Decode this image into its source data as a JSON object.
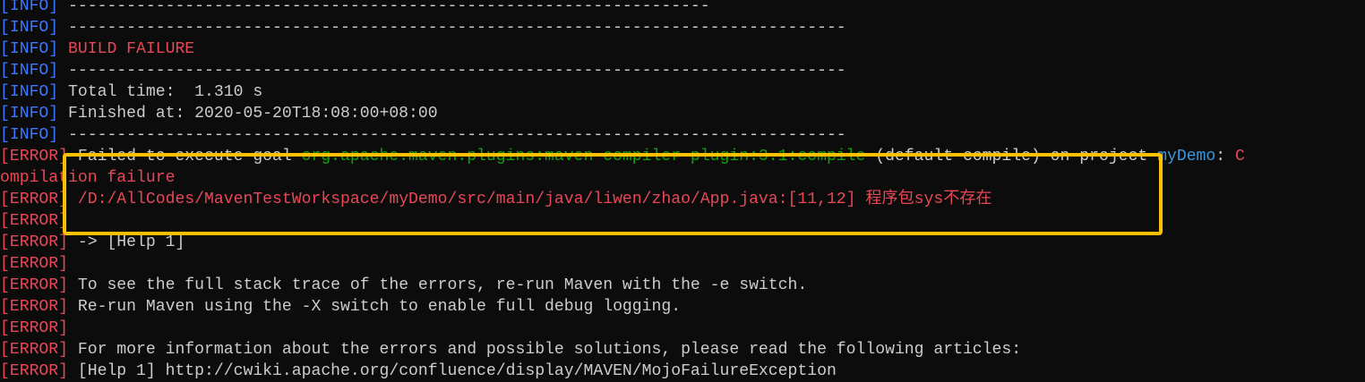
{
  "colors": {
    "gray": "#cccccc",
    "blue": "#3b78ff",
    "red": "#e74856",
    "green": "#13a10e",
    "cyan": "#3a96dd",
    "highlight": "#ffc000",
    "background": "#0c0c0c"
  },
  "lines": [
    [
      {
        "t": "[INFO]",
        "c": "blue"
      },
      {
        "t": " ------------------------------------------------------------------",
        "c": "gray"
      }
    ],
    [
      {
        "t": "[INFO]",
        "c": "blue"
      },
      {
        "t": " --------------------------------------------------------------------------------",
        "c": "gray"
      }
    ],
    [
      {
        "t": "[INFO]",
        "c": "blue"
      },
      {
        "t": " ",
        "c": "gray"
      },
      {
        "t": "BUILD FAILURE",
        "c": "red"
      }
    ],
    [
      {
        "t": "[INFO]",
        "c": "blue"
      },
      {
        "t": " --------------------------------------------------------------------------------",
        "c": "gray"
      }
    ],
    [
      {
        "t": "[INFO]",
        "c": "blue"
      },
      {
        "t": " Total time:  1.310 s",
        "c": "gray"
      }
    ],
    [
      {
        "t": "[INFO]",
        "c": "blue"
      },
      {
        "t": " Finished at: 2020-05-20T18:08:00+08:00",
        "c": "gray"
      }
    ],
    [
      {
        "t": "[INFO]",
        "c": "blue"
      },
      {
        "t": " --------------------------------------------------------------------------------",
        "c": "gray"
      }
    ],
    [
      {
        "t": "[ERROR]",
        "c": "red"
      },
      {
        "t": " Failed to execute goal ",
        "c": "gray"
      },
      {
        "t": "org.apache.maven.plugins:maven-compiler-plugin:3.1:compile",
        "c": "green"
      },
      {
        "t": " (default-compile) on project ",
        "c": "gray"
      },
      {
        "t": "myDemo",
        "c": "cyan"
      },
      {
        "t": ": ",
        "c": "gray"
      },
      {
        "t": "C",
        "c": "red"
      }
    ],
    [
      {
        "t": "ompilation failure",
        "c": "red"
      }
    ],
    [
      {
        "t": "[ERROR]",
        "c": "red"
      },
      {
        "t": " /D:/AllCodes/MavenTestWorkspace/myDemo/src/main/java/liwen/zhao/App.java:[11,12] 程序包sys不存在",
        "c": "red"
      }
    ],
    [
      {
        "t": "[ERROR]",
        "c": "red"
      }
    ],
    [
      {
        "t": "[ERROR]",
        "c": "red"
      },
      {
        "t": " -> [Help 1]",
        "c": "gray"
      }
    ],
    [
      {
        "t": "[ERROR]",
        "c": "red"
      }
    ],
    [
      {
        "t": "[ERROR]",
        "c": "red"
      },
      {
        "t": " To see the full stack trace of the errors, re-run Maven with the -e switch.",
        "c": "gray"
      }
    ],
    [
      {
        "t": "[ERROR]",
        "c": "red"
      },
      {
        "t": " Re-run Maven using the -X switch to enable full debug logging.",
        "c": "gray"
      }
    ],
    [
      {
        "t": "[ERROR]",
        "c": "red"
      }
    ],
    [
      {
        "t": "[ERROR]",
        "c": "red"
      },
      {
        "t": " For more information about the errors and possible solutions, please read the following articles:",
        "c": "gray"
      }
    ],
    [
      {
        "t": "[ERROR]",
        "c": "red"
      },
      {
        "t": " [Help 1] http://cwiki.apache.org/confluence/display/MAVEN/MojoFailureException",
        "c": "gray"
      }
    ]
  ]
}
